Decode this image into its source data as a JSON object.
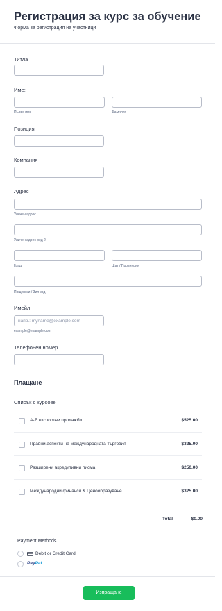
{
  "header": {
    "title": "Регистрация за курс за обучение",
    "subtitle": "Форма за регистрация на участници"
  },
  "fields": {
    "title_label": "Титла",
    "name_label": "Име:",
    "first_name_sublabel": "Първо име",
    "last_name_sublabel": "Фамилия",
    "position_label": "Позиция",
    "company_label": "Компания",
    "address_label": "Адрес",
    "street_sublabel": "Уличен адрес",
    "street2_sublabel": "Уличен адрес ред 2",
    "city_sublabel": "Град",
    "state_sublabel": "Щат / Провинция",
    "zip_sublabel": "Пощенски / Зип код",
    "email_label": "Имейл",
    "email_placeholder": "напр.: myname@example.com",
    "email_sublabel": "example@example.com",
    "phone_label": "Телефонен номер"
  },
  "payment": {
    "section_title": "Плащане",
    "list_title": "Списък с курсове",
    "products": [
      {
        "name": "А-Я експортни продажби",
        "price": "$525.00"
      },
      {
        "name": "Правни аспекти на международната търговия",
        "price": "$325.00"
      },
      {
        "name": "Разширени акредитивни писма",
        "price": "$250.00"
      },
      {
        "name": "Международни финанси & Ценообразуване",
        "price": "$325.00"
      }
    ],
    "total_label": "Total",
    "total_value": "$0.00",
    "methods_title": "Payment Methods",
    "method_card": "Debit or Credit Card",
    "method_paypal_1": "Pay",
    "method_paypal_2": "Pal"
  },
  "submit_label": "Изпращане",
  "colors": {
    "submit": "#18bd5b",
    "text": "#2c3345",
    "paypal_dark": "#253b80",
    "paypal_light": "#179bd7"
  }
}
